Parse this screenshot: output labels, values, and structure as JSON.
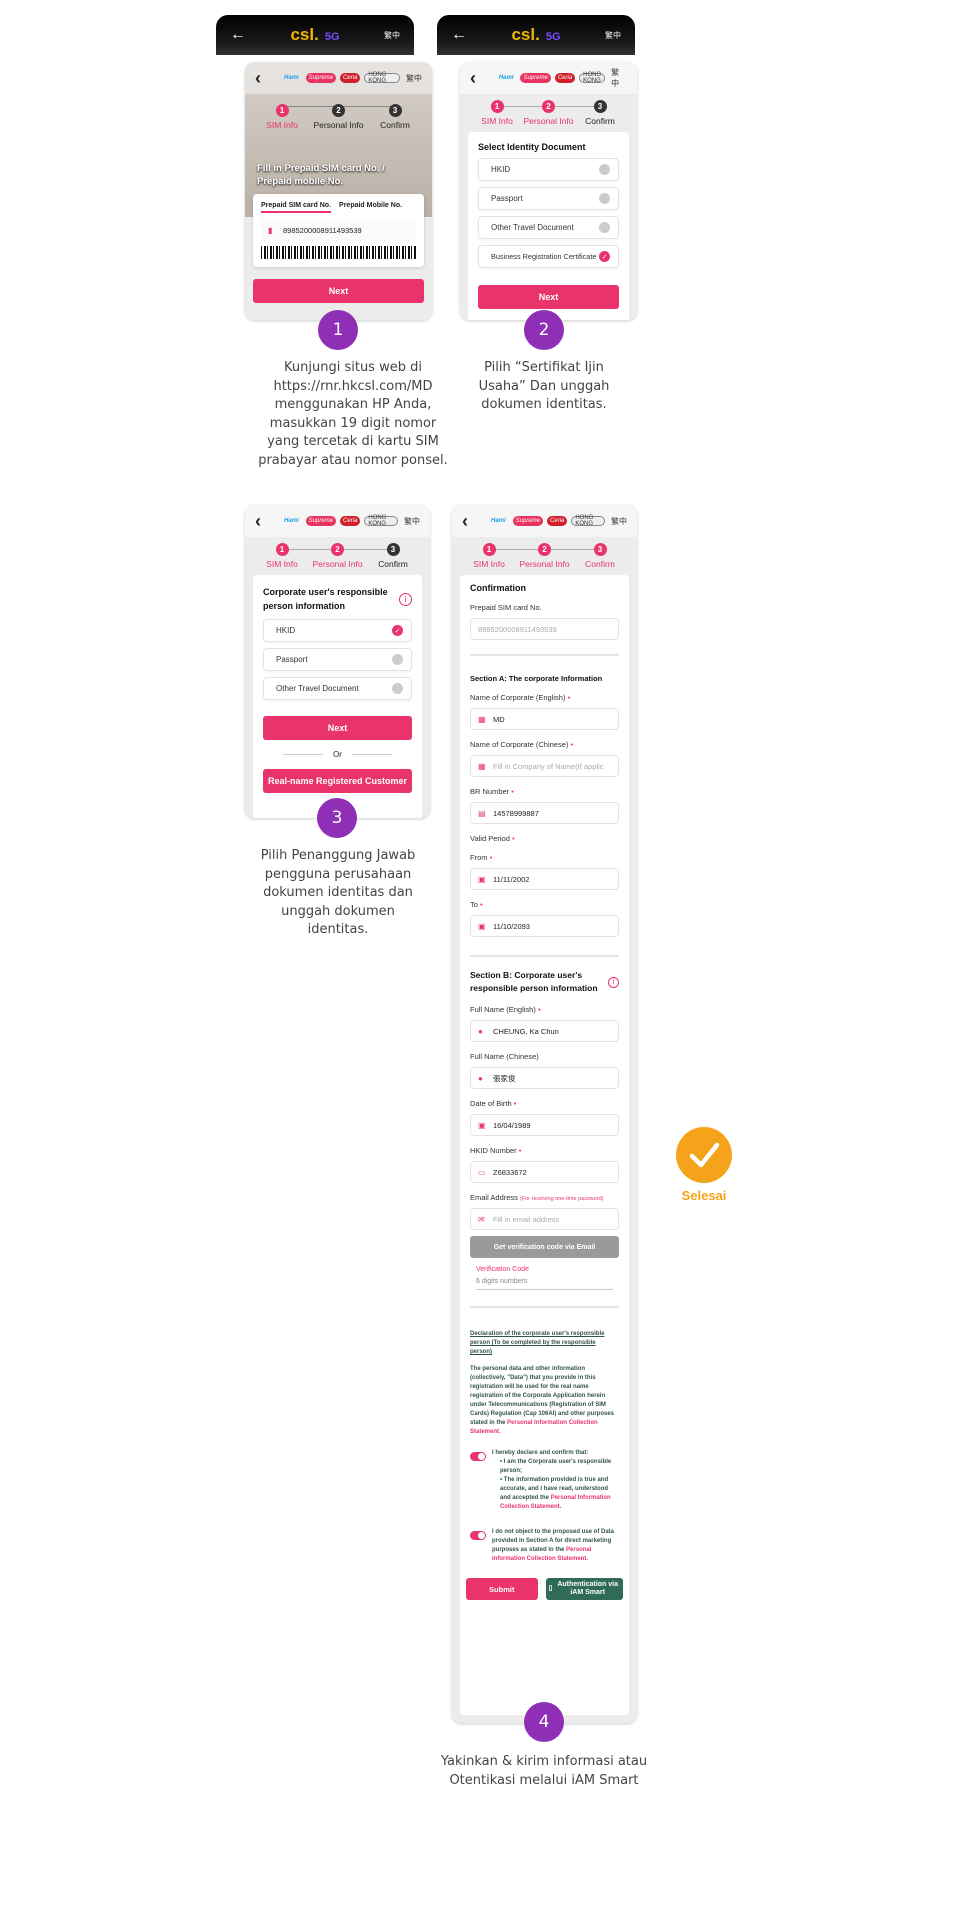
{
  "topbar": {
    "brand": "csl.",
    "network": "5G",
    "lang": "繁中",
    "back": "←"
  },
  "app": {
    "back": "‹",
    "lang": "繁中",
    "logos": [
      "Hami",
      "Supreme",
      "Ceria",
      "HONG KONG"
    ],
    "steps": [
      "SIM Info",
      "Personal Info",
      "Confirm"
    ]
  },
  "screen1": {
    "hero": "Fill in Prepaid SIM card No. / Prepaid mobile No.",
    "tabs": [
      "Prepaid SIM card No.",
      "Prepaid Mobile No."
    ],
    "sim_value": "8985200008911493539",
    "next": "Next"
  },
  "screen2": {
    "title": "Select Identity Document",
    "options": [
      "HKID",
      "Passport",
      "Other Travel Document",
      "Business Registration Certificate"
    ],
    "selected": 3,
    "next": "Next"
  },
  "screen3": {
    "title": "Corporate user's responsible person information",
    "options": [
      "HKID",
      "Passport",
      "Other Travel Document"
    ],
    "selected": 0,
    "next": "Next",
    "or": "Or",
    "registered": "Real-name Registered Customer"
  },
  "screen4": {
    "title": "Confirmation",
    "sim_label": "Prepaid SIM card No.",
    "sim_value": "8985200008911493539",
    "sectionA": "Section A: The corporate Information",
    "corp_en_label": "Name of Corporate (English)",
    "corp_en": "MD",
    "corp_zh_label": "Name of Corporate (Chinese)",
    "corp_zh_ph": "Fill in Company of Name(If applic",
    "br_label": "BR Number",
    "br": "14578999887",
    "valid_label": "Valid Period",
    "from_label": "From",
    "from": "11/11/2002",
    "to_label": "To",
    "to": "11/10/2093",
    "sectionB": "Section B: Corporate user's responsible person information",
    "name_en_label": "Full Name (English)",
    "name_en": "CHEUNG, Ka  Chun",
    "name_zh_label": "Full Name (Chinese)",
    "name_zh": "張家俊",
    "dob_label": "Date of Birth",
    "dob": "16/04/1989",
    "hkid_label": "HKID Number",
    "hkid": "Z6833672",
    "email_label": "Email Address",
    "email_note": "(For receiving one-time password)",
    "email_ph": "Fill in email address",
    "get_code": "Get verification code via Email",
    "code_label": "Verification Code",
    "code_ph": "6 digits numbers",
    "decl_title": "Declaration of the corporate user's responsible person (To be completed by the responsible person)",
    "decl_text": "The personal data and other information (collectively, \"Data\") that you provide in this registration will be used for the real name registration of the Corporate Application herein under Telecommunications (Registration of SIM Cards) Regulation (Cap 106AI) and other purposes stated in the",
    "pics": "Personal Information Collection Statement.",
    "confirm_intro": "I hereby declare and confirm that:",
    "bullet1": "I am the Corporate user's responsible person;",
    "bullet2": "The information provided is true and accurate, and I have read, understood and accepted the",
    "marketing": "I do not object to the proposed use of Data provided in Section A for direct marketing purposes as stated in the",
    "submit": "Submit",
    "iam": "Authentication via iAM Smart"
  },
  "steps_caption": [
    {
      "num": "1",
      "text": "Kunjungi situs web di https://rnr.hkcsl.com/MD menggunakan HP Anda, masukkan 19 digit nomor yang tercetak di kartu SIM prabayar atau nomor ponsel."
    },
    {
      "num": "2",
      "text": "Pilih “Sertifikat Ijin Usaha” Dan unggah dokumen identitas."
    },
    {
      "num": "3",
      "text": "Pilih Penanggung Jawab pengguna perusahaan dokumen identitas dan unggah dokumen identitas."
    },
    {
      "num": "4",
      "text": "Yakinkan & kirim informasi atau Otentikasi melalui iAM Smart"
    }
  ],
  "done": {
    "label": "Selesai",
    "color": "#f5a31a"
  },
  "colors": {
    "accent": "#e8336b",
    "step_badge": "#8e2fb5",
    "iam": "#2f6b56"
  }
}
